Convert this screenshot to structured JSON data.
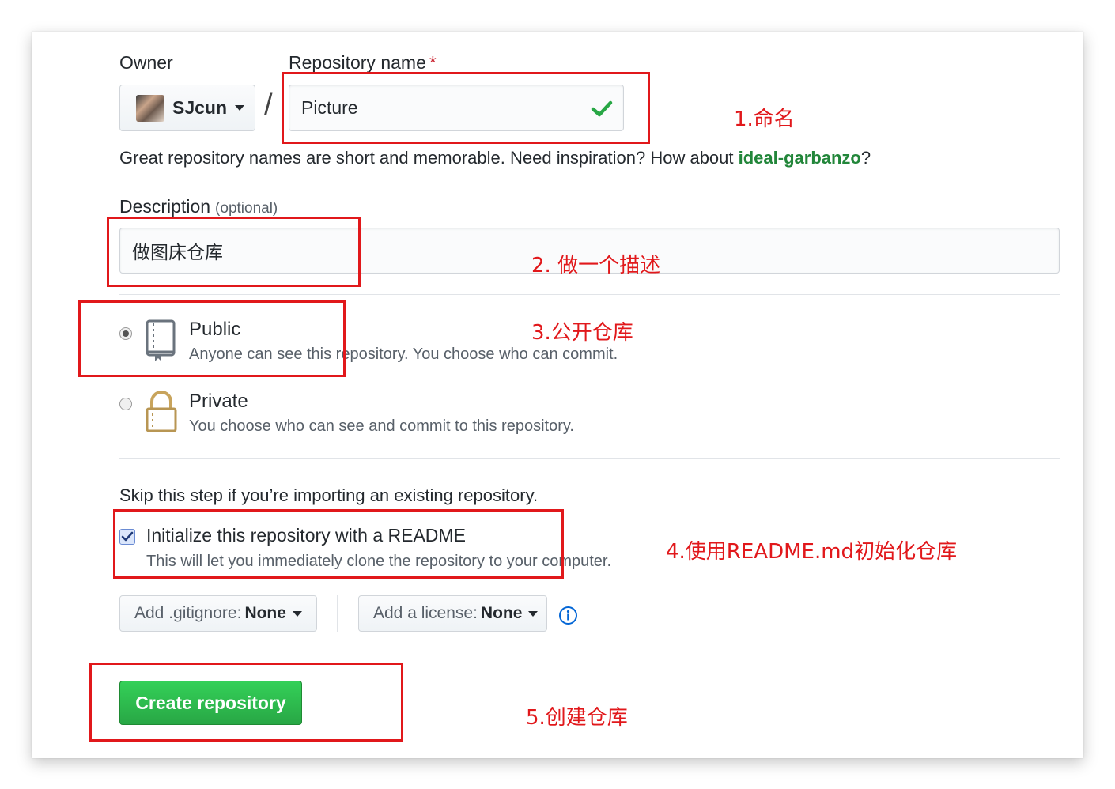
{
  "form": {
    "owner_label": "Owner",
    "repo_label": "Repository name",
    "required_mark": "*",
    "owner_value": "SJcun",
    "slash": "/",
    "repo_value": "Picture",
    "hint_prefix": "Great repository names are short and memorable. Need inspiration? How about ",
    "hint_suggestion": "ideal-garbanzo",
    "hint_suffix": "?",
    "description_label": "Description",
    "description_optional": "(optional)",
    "description_value": "做图床仓库",
    "public_title": "Public",
    "public_desc": "Anyone can see this repository. You choose who can commit.",
    "private_title": "Private",
    "private_desc": "You choose who can see and commit to this repository.",
    "skip_text": "Skip this step if you’re importing an existing repository.",
    "init_title": "Initialize this repository with a README",
    "init_desc": "This will let you immediately clone the repository to your computer.",
    "gitignore_prefix": "Add .gitignore:",
    "gitignore_value": "None",
    "license_prefix": "Add a license:",
    "license_value": "None",
    "create_button": "Create repository",
    "visibility_selected": "public",
    "readme_checked": true
  },
  "annotations": {
    "step1": "1.命名",
    "step2": "2. 做一个描述",
    "step3": "3.公开仓库",
    "step4": "4.使用README.md初始化仓库",
    "step5": "5.创建仓库"
  },
  "colors": {
    "annotation": "#e1181b",
    "create_button": "#28a745",
    "suggestion": "#22863a"
  },
  "icons": [
    "caret-down-icon",
    "checkmark-icon",
    "repo-book-icon",
    "lock-icon",
    "info-icon",
    "checkbox-checked-icon"
  ]
}
